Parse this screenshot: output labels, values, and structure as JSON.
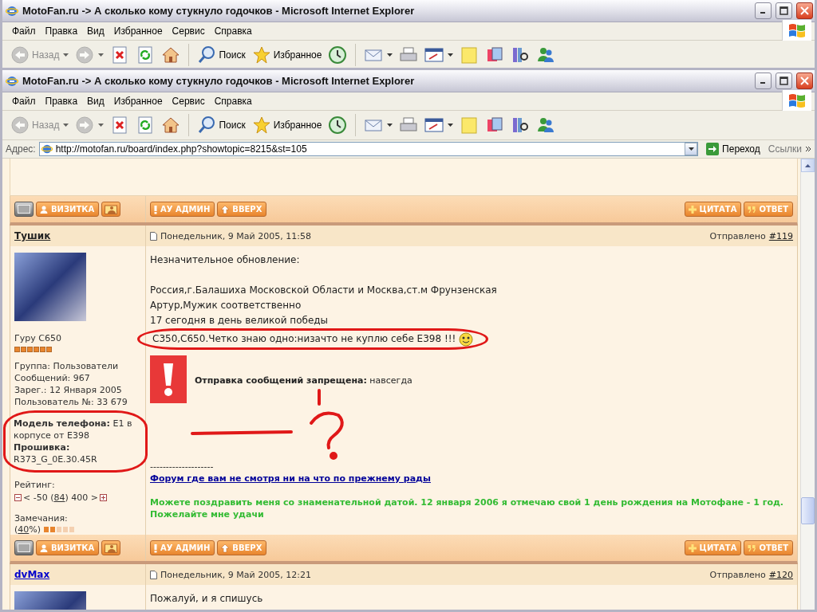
{
  "windows": [
    {
      "title": "MotoFan.ru -> А сколько кому стукнуло годочков - Microsoft Internet Explorer",
      "menu": [
        "Файл",
        "Правка",
        "Вид",
        "Избранное",
        "Сервис",
        "Справка"
      ],
      "toolbar": [
        [
          {
            "kind": "back",
            "label": "Назад",
            "disabled": true,
            "dropdown": true
          },
          {
            "kind": "forward",
            "disabled": true,
            "dropdown": true
          },
          {
            "kind": "stop",
            "disabled": false,
            "dropdown": false
          },
          {
            "kind": "refresh",
            "disabled": false,
            "dropdown": false
          },
          {
            "kind": "home",
            "disabled": false,
            "dropdown": false
          }
        ],
        [
          {
            "kind": "search",
            "label": "Поиск",
            "disabled": false,
            "dropdown": false
          },
          {
            "kind": "favorites",
            "label": "Избранное",
            "disabled": false,
            "dropdown": false
          },
          {
            "kind": "history",
            "disabled": false,
            "dropdown": false
          }
        ],
        [
          {
            "kind": "mail",
            "disabled": false,
            "dropdown": true
          },
          {
            "kind": "print",
            "disabled": false,
            "dropdown": false
          },
          {
            "kind": "edit",
            "disabled": false,
            "dropdown": true
          },
          {
            "kind": "note",
            "disabled": false,
            "dropdown": false
          },
          {
            "kind": "research",
            "disabled": false,
            "dropdown": false
          },
          {
            "kind": "books",
            "disabled": false,
            "dropdown": false
          },
          {
            "kind": "messenger",
            "disabled": false,
            "dropdown": false
          }
        ]
      ]
    },
    {
      "title": "MotoFan.ru -> А сколько кому стукнуло годочков - Microsoft Internet Explorer",
      "menu": [
        "Файл",
        "Правка",
        "Вид",
        "Избранное",
        "Сервис",
        "Справка"
      ],
      "toolbar": [
        [
          {
            "kind": "back",
            "label": "Назад",
            "disabled": true,
            "dropdown": true
          },
          {
            "kind": "forward",
            "disabled": true,
            "dropdown": true
          },
          {
            "kind": "stop",
            "disabled": false,
            "dropdown": false
          },
          {
            "kind": "refresh",
            "disabled": false,
            "dropdown": false
          },
          {
            "kind": "home",
            "disabled": false,
            "dropdown": false
          }
        ],
        [
          {
            "kind": "search",
            "label": "Поиск",
            "disabled": false,
            "dropdown": false
          },
          {
            "kind": "favorites",
            "label": "Избранное",
            "disabled": false,
            "dropdown": false
          },
          {
            "kind": "history",
            "disabled": false,
            "dropdown": false
          }
        ],
        [
          {
            "kind": "mail",
            "disabled": false,
            "dropdown": true
          },
          {
            "kind": "print",
            "disabled": false,
            "dropdown": false
          },
          {
            "kind": "edit",
            "disabled": false,
            "dropdown": true
          },
          {
            "kind": "note",
            "disabled": false,
            "dropdown": false
          },
          {
            "kind": "research",
            "disabled": false,
            "dropdown": false
          },
          {
            "kind": "books",
            "disabled": false,
            "dropdown": false
          },
          {
            "kind": "messenger",
            "disabled": false,
            "dropdown": false
          }
        ]
      ],
      "address": {
        "label": "Адрес:",
        "value": "http://motofan.ru/board/index.php?showtopic=8215&st=105",
        "go": "Переход",
        "links": "Ссылки"
      }
    }
  ],
  "forum": [
    {
      "kind": "actions",
      "user_buttons": [
        {
          "kind": "status"
        },
        {
          "kind": "profile",
          "label": "ВИЗИТКА"
        },
        {
          "kind": "photo"
        }
      ],
      "post_buttons": [
        {
          "kind": "report",
          "label": "АУ АДМИН"
        },
        {
          "kind": "top",
          "label": "ВВЕРХ"
        }
      ],
      "reply_buttons": [
        {
          "kind": "multiquote",
          "label": "ЦИТАТА"
        },
        {
          "kind": "reply",
          "label": "ОТВЕТ"
        }
      ]
    },
    {
      "kind": "post",
      "author": "Тушик",
      "visited": true,
      "date": "Понедельник, 9 Май 2005, 11:58",
      "sent_label": "Отправлено",
      "number": "#119",
      "rank": "Гуру C650",
      "stars": 6,
      "info": [
        {
          "label": "Группа:",
          "value": "Пользователи",
          "bold": false,
          "circled": false
        },
        {
          "label": "Сообщений:",
          "value": "967",
          "bold": false,
          "circled": false
        },
        {
          "label": "Зарег.:",
          "value": "12 Января 2005",
          "bold": false,
          "circled": false
        },
        {
          "label": "Пользователь №:",
          "value": "33 679",
          "bold": false,
          "circled": false
        },
        {
          "label": "Модель телефона:",
          "value": "E1 в корпусе от E398",
          "bold": true,
          "circled": true
        },
        {
          "label": "Прошивка:",
          "value": "R373_G_0E.30.45R",
          "bold": true,
          "circled": true
        }
      ],
      "rating": {
        "label": "Рейтинг:",
        "before": "< -50 (",
        "value": "84",
        "after": ") 400 >"
      },
      "warnings": {
        "label": "Замечания:",
        "before": "(",
        "percent": "40",
        "after": "%)",
        "level": 0.4
      },
      "body": [
        [
          {
            "text": "Незначительное обновление:",
            "smiley": false,
            "circled": false
          }
        ],
        [
          {
            "text": "Россия,г.Балашиха Московской Области и Москва,ст.м Фрунзенская",
            "smiley": false,
            "circled": false
          },
          {
            "text": "Артур,Мужик соответственно",
            "smiley": false,
            "circled": false
          },
          {
            "text": "17 сегодня в день великой победы",
            "smiley": false,
            "circled": false
          },
          {
            "text": "C350,C650.Четко знаю одно:низачто не куплю себе E398 !!!",
            "smiley": true,
            "circled": true
          }
        ]
      ],
      "notice": "**Отправка сообщений запрещена:** навсегда",
      "signature": {
        "rule": "--------------------",
        "link": "Форум где вам не смотря ни на что по прежнему рады",
        "text": "Можете поздравить меня со знаменательной датой. 12 января 2006 я отмечаю свой 1 день рождения на Мотофане - 1 год. Пожелайте мне удачи"
      }
    },
    {
      "kind": "actions",
      "user_buttons": [
        {
          "kind": "status"
        },
        {
          "kind": "profile",
          "label": "ВИЗИТКА"
        },
        {
          "kind": "photo"
        }
      ],
      "post_buttons": [
        {
          "kind": "report",
          "label": "АУ АДМИН"
        },
        {
          "kind": "top",
          "label": "ВВЕРХ"
        }
      ],
      "reply_buttons": [
        {
          "kind": "multiquote",
          "label": "ЦИТАТА"
        },
        {
          "kind": "reply",
          "label": "ОТВЕТ"
        }
      ]
    },
    {
      "kind": "post",
      "author": "dvMax",
      "visited": false,
      "date": "Понедельник, 9 Май 2005, 12:21",
      "sent_label": "Отправлено",
      "number": "#120",
      "body": [
        [
          {
            "text": "Пожалуй, и я спишусь",
            "smiley": false,
            "circled": false
          }
        ]
      ]
    }
  ]
}
